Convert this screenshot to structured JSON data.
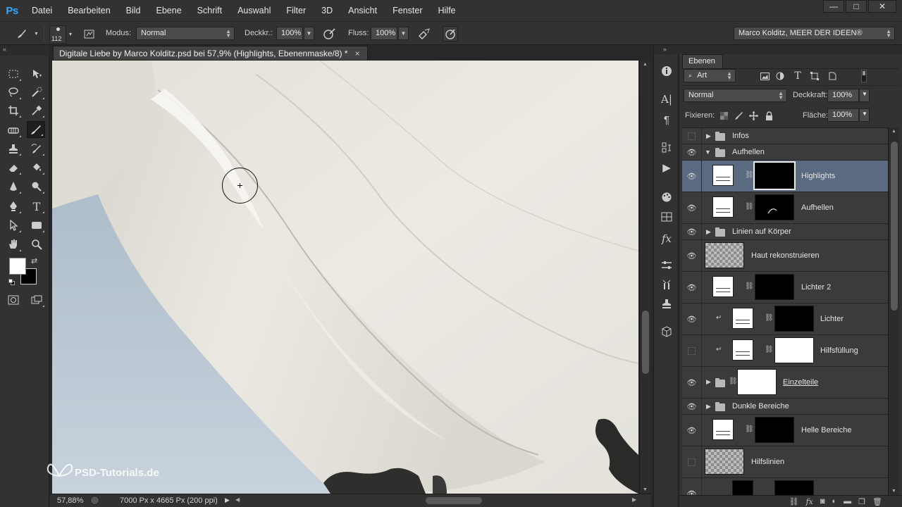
{
  "app": {
    "logo": "Ps",
    "menu": [
      "Datei",
      "Bearbeiten",
      "Bild",
      "Ebene",
      "Schrift",
      "Auswahl",
      "Filter",
      "3D",
      "Ansicht",
      "Fenster",
      "Hilfe"
    ],
    "window_controls": {
      "minimize": "—",
      "maximize": "□",
      "close": "✕"
    }
  },
  "options": {
    "brush_size": "112",
    "mode_label": "Modus:",
    "mode_value": "Normal",
    "opacity_label": "Deckkr.:",
    "opacity_value": "100%",
    "flow_label": "Fluss:",
    "flow_value": "100%",
    "workspace": "Marco Kolditz, MEER DER IDEEN®"
  },
  "document": {
    "tab_title": "Digitale Liebe by Marco Kolditz.psd bei 57,9% (Highlights, Ebenenmaske/8) *",
    "tab_close": "×",
    "zoom": "57,88%",
    "dimensions": "7000 Px x 4665 Px (200 ppi)",
    "watermark": "PSD-Tutorials.de"
  },
  "layers_panel": {
    "tab": "Ebenen",
    "filter_kind": "Art",
    "blend_mode": "Normal",
    "opacity_label": "Deckkraft:",
    "opacity_value": "100%",
    "lock_label": "Fixieren:",
    "fill_label": "Fläche:",
    "fill_value": "100%",
    "layers": [
      {
        "name": "Infos",
        "type": "group",
        "visible": false
      },
      {
        "name": "Aufhellen",
        "type": "group-open",
        "visible": true
      },
      {
        "name": "Highlights",
        "type": "adjustment",
        "visible": true,
        "selected": true
      },
      {
        "name": "Aufhellen",
        "type": "adjustment",
        "visible": true
      },
      {
        "name": "Linien auf Körper",
        "type": "group",
        "visible": true
      },
      {
        "name": "Haut rekonstruieren",
        "type": "pixel",
        "visible": true
      },
      {
        "name": "Lichter 2",
        "type": "adjustment",
        "visible": true
      },
      {
        "name": "Lichter",
        "type": "adjustment",
        "visible": true,
        "clipped": true
      },
      {
        "name": "Hilfsfüllung",
        "type": "adjustment",
        "visible": false,
        "clipped": true
      },
      {
        "name": "Einzelteile",
        "type": "group-mask",
        "visible": true
      },
      {
        "name": "Dunkle Bereiche",
        "type": "group",
        "visible": true
      },
      {
        "name": "Helle Bereiche",
        "type": "adjustment",
        "visible": true
      },
      {
        "name": "Hilfslinien",
        "type": "pixel",
        "visible": false
      }
    ],
    "footer_icons": [
      "link-icon",
      "fx-icon",
      "mask-icon",
      "adjustment-icon",
      "group-icon",
      "new-layer-icon",
      "trash-icon"
    ]
  }
}
